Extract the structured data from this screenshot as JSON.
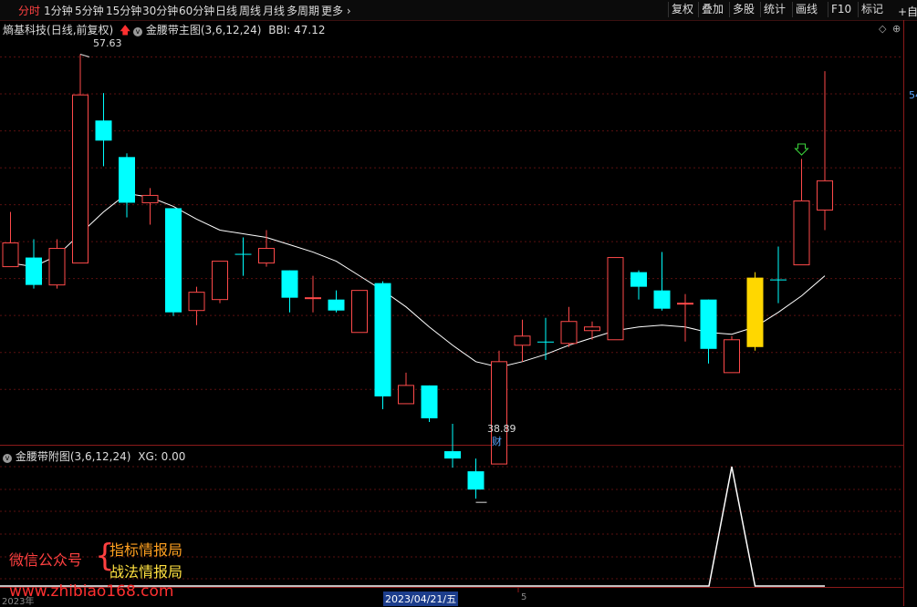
{
  "toolbar": {
    "periods": [
      "分时",
      "1分钟",
      "5分钟",
      "15分钟",
      "30分钟",
      "60分钟",
      "日线",
      "周线",
      "月线",
      "多周期",
      "更多"
    ],
    "active_period": "分时",
    "right_buttons": [
      "复权",
      "叠加",
      "多股",
      "统计",
      "画线",
      "F10",
      "标记"
    ],
    "more_arrow": "›"
  },
  "main_panel": {
    "stock_name": "熵基科技",
    "mode": "(日线,前复权)",
    "indicator": "金腰带主图(3,6,12,24)",
    "bbi_label": "BBI: 47.12",
    "price_right": "54",
    "add_watch": "+自选"
  },
  "sub_panel": {
    "indicator": "金腰带附图(3,6,12,24)",
    "xg_label": "XG: 0.00"
  },
  "xaxis": {
    "left_label": "2023年",
    "date_label": "2023/04/21/五",
    "month_mark": "5"
  },
  "watermark": {
    "left": "微信公众号",
    "brace": "{",
    "line1": "指标情报局",
    "line2": "战法情报局",
    "url": "www.zhibiao168.com"
  },
  "colors": {
    "up": "#ff4a4a",
    "down": "#00ffff",
    "bbi": "#ffffff",
    "highlight": "#ffd700",
    "grid": "#5a1010"
  },
  "chart_data": {
    "type": "candlestick",
    "title": "金腰带主图(3,6,12,24)",
    "annotations": {
      "high": "57.63",
      "low": "38.89",
      "low_marker": "财"
    },
    "ylim": [
      37,
      59
    ],
    "candles": [
      {
        "o": 47.3,
        "c": 46.0,
        "h": 49.0,
        "l": 46.0,
        "t": "up"
      },
      {
        "o": 46.5,
        "c": 45.0,
        "h": 47.5,
        "l": 44.8,
        "t": "down"
      },
      {
        "o": 45.0,
        "c": 47.0,
        "h": 47.5,
        "l": 44.8,
        "t": "up"
      },
      {
        "o": 46.2,
        "c": 55.4,
        "h": 57.63,
        "l": 46.2,
        "t": "up"
      },
      {
        "o": 54.0,
        "c": 52.9,
        "h": 55.5,
        "l": 51.5,
        "t": "down"
      },
      {
        "o": 52.0,
        "c": 49.5,
        "h": 52.2,
        "l": 48.7,
        "t": "down"
      },
      {
        "o": 49.5,
        "c": 49.9,
        "h": 50.3,
        "l": 48.3,
        "t": "up"
      },
      {
        "o": 49.2,
        "c": 43.5,
        "h": 49.2,
        "l": 43.3,
        "t": "down"
      },
      {
        "o": 43.6,
        "c": 44.6,
        "h": 44.9,
        "l": 42.8,
        "t": "up"
      },
      {
        "o": 44.2,
        "c": 46.3,
        "h": 46.3,
        "l": 44.0,
        "t": "up"
      },
      {
        "o": 46.7,
        "c": 46.7,
        "h": 47.6,
        "l": 45.5,
        "t": "down"
      },
      {
        "o": 46.2,
        "c": 47.0,
        "h": 48.0,
        "l": 46.0,
        "t": "up"
      },
      {
        "o": 45.8,
        "c": 44.3,
        "h": 45.8,
        "l": 43.5,
        "t": "down"
      },
      {
        "o": 44.3,
        "c": 44.3,
        "h": 45.5,
        "l": 43.5,
        "t": "up"
      },
      {
        "o": 44.2,
        "c": 43.6,
        "h": 44.7,
        "l": 43.5,
        "t": "down"
      },
      {
        "o": 42.4,
        "c": 44.7,
        "h": 44.7,
        "l": 42.4,
        "t": "up"
      },
      {
        "o": 45.1,
        "c": 38.9,
        "h": 45.2,
        "l": 38.2,
        "t": "down"
      },
      {
        "o": 38.5,
        "c": 39.5,
        "h": 40.2,
        "l": 38.5,
        "t": "up"
      },
      {
        "o": 39.5,
        "c": 37.7,
        "h": 39.5,
        "l": 37.5,
        "t": "down"
      },
      {
        "o": 35.9,
        "c": 35.5,
        "h": 37.4,
        "l": 35.0,
        "t": "down"
      },
      {
        "o": 34.8,
        "c": 33.8,
        "h": 35.5,
        "l": 33.3,
        "t": "down"
      },
      {
        "o": 35.2,
        "c": 40.8,
        "h": 41.4,
        "l": 35.2,
        "t": "up"
      },
      {
        "o": 41.7,
        "c": 42.2,
        "h": 43.1,
        "l": 40.8,
        "t": "up"
      },
      {
        "o": 41.9,
        "c": 41.9,
        "h": 43.2,
        "l": 40.9,
        "t": "down"
      },
      {
        "o": 41.8,
        "c": 43.0,
        "h": 43.8,
        "l": 41.6,
        "t": "up"
      },
      {
        "o": 42.5,
        "c": 42.7,
        "h": 43.0,
        "l": 42.0,
        "t": "up"
      },
      {
        "o": 42.0,
        "c": 46.5,
        "h": 46.5,
        "l": 42.0,
        "t": "up"
      },
      {
        "o": 45.7,
        "c": 44.9,
        "h": 45.8,
        "l": 44.2,
        "t": "down"
      },
      {
        "o": 44.7,
        "c": 43.7,
        "h": 46.8,
        "l": 43.6,
        "t": "down"
      },
      {
        "o": 44.0,
        "c": 44.0,
        "h": 44.5,
        "l": 41.9,
        "t": "up"
      },
      {
        "o": 44.2,
        "c": 41.5,
        "h": 44.2,
        "l": 40.7,
        "t": "down"
      },
      {
        "o": 40.2,
        "c": 42.0,
        "h": 42.2,
        "l": 40.2,
        "t": "up"
      },
      {
        "o": 41.6,
        "c": 45.4,
        "h": 45.7,
        "l": 41.4,
        "t": "up"
      },
      {
        "o": 45.3,
        "c": 45.3,
        "h": 47.1,
        "l": 44.0,
        "t": "down"
      },
      {
        "o": 46.1,
        "c": 49.6,
        "h": 51.9,
        "l": 46.1,
        "t": "up"
      },
      {
        "o": 49.1,
        "c": 50.7,
        "h": 56.7,
        "l": 48.0,
        "t": "up"
      }
    ],
    "highlight_index": 32,
    "arrow_index": 34,
    "bbi": [
      46.2,
      46.0,
      46.6,
      47.8,
      49.0,
      50.0,
      49.8,
      49.3,
      48.6,
      48.0,
      47.8,
      47.6,
      47.2,
      46.8,
      46.3,
      45.5,
      44.7,
      43.8,
      42.7,
      41.7,
      40.8,
      40.5,
      40.8,
      41.2,
      41.7,
      42.1,
      42.5,
      42.7,
      42.8,
      42.7,
      42.4,
      42.3,
      42.7,
      43.5,
      44.4,
      45.5
    ]
  },
  "sub_chart_data": {
    "type": "line",
    "title": "金腰带附图(3,6,12,24)",
    "values": [
      0,
      0,
      0,
      0,
      0,
      0,
      0,
      0,
      0,
      0,
      0,
      0,
      0,
      0,
      0,
      0,
      0,
      0,
      0,
      0,
      0,
      0,
      0,
      0,
      0,
      0,
      0,
      0,
      0,
      0,
      0,
      1,
      1,
      0,
      0,
      0
    ],
    "ylim": [
      0,
      1
    ]
  }
}
